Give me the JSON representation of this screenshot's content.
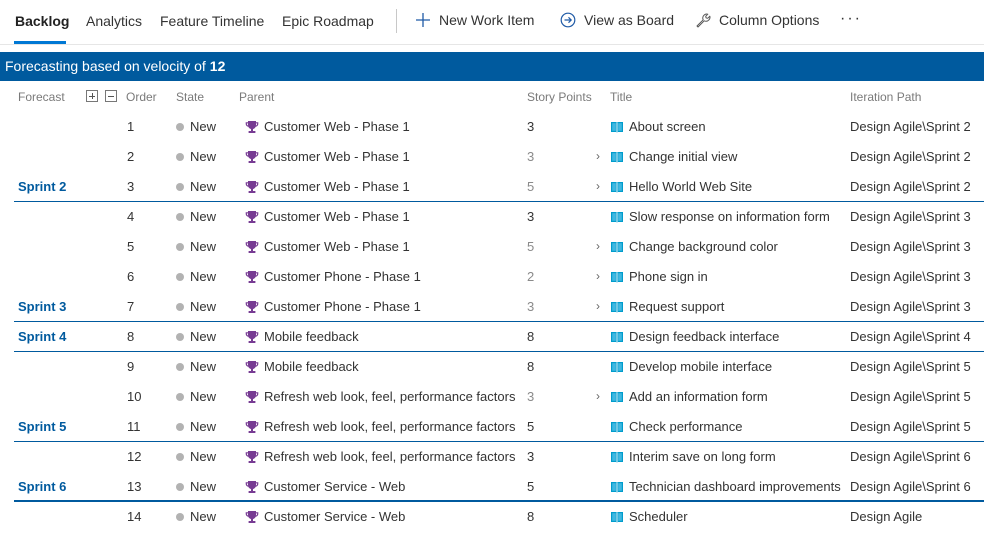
{
  "tabs": [
    {
      "label": "Backlog",
      "active": true
    },
    {
      "label": "Analytics",
      "active": false
    },
    {
      "label": "Feature Timeline",
      "active": false
    },
    {
      "label": "Epic Roadmap",
      "active": false
    }
  ],
  "toolbar": {
    "new_item": "New Work Item",
    "view_board": "View as Board",
    "column_options": "Column Options",
    "more": "···"
  },
  "banner": {
    "text": "Forecasting based on velocity of",
    "velocity": "12"
  },
  "colors": {
    "accent": "#005a9e",
    "tab_underline": "#0078d4",
    "epic_icon": "#773b93",
    "story_icon": "#009ccc",
    "state_new": "#b2b2b2"
  },
  "columns": {
    "forecast": "Forecast",
    "order": "Order",
    "state": "State",
    "parent": "Parent",
    "story_points": "Story Points",
    "title": "Title",
    "iteration_path": "Iteration Path"
  },
  "rows": [
    {
      "forecast": "",
      "order": "1",
      "state": "New",
      "parent": "Customer Web - Phase 1",
      "points": "3",
      "points_muted": false,
      "has_children": false,
      "title": "About screen",
      "path": "Design Agile\\Sprint 2",
      "sep": ""
    },
    {
      "forecast": "",
      "order": "2",
      "state": "New",
      "parent": "Customer Web - Phase 1",
      "points": "3",
      "points_muted": true,
      "has_children": true,
      "title": "Change initial view",
      "path": "Design Agile\\Sprint 2",
      "sep": ""
    },
    {
      "forecast": "Sprint 2",
      "order": "3",
      "state": "New",
      "parent": "Customer Web - Phase 1",
      "points": "5",
      "points_muted": true,
      "has_children": true,
      "title": "Hello World Web Site",
      "path": "Design Agile\\Sprint 2",
      "sep": "thin"
    },
    {
      "forecast": "",
      "order": "4",
      "state": "New",
      "parent": "Customer Web - Phase 1",
      "points": "3",
      "points_muted": false,
      "has_children": false,
      "title": "Slow response on information form",
      "path": "Design Agile\\Sprint 3",
      "sep": ""
    },
    {
      "forecast": "",
      "order": "5",
      "state": "New",
      "parent": "Customer Web - Phase 1",
      "points": "5",
      "points_muted": true,
      "has_children": true,
      "title": "Change background color",
      "path": "Design Agile\\Sprint 3",
      "sep": ""
    },
    {
      "forecast": "",
      "order": "6",
      "state": "New",
      "parent": "Customer Phone - Phase 1",
      "points": "2",
      "points_muted": true,
      "has_children": true,
      "title": "Phone sign in",
      "path": "Design Agile\\Sprint 3",
      "sep": ""
    },
    {
      "forecast": "Sprint 3",
      "order": "7",
      "state": "New",
      "parent": "Customer Phone - Phase 1",
      "points": "3",
      "points_muted": true,
      "has_children": true,
      "title": "Request support",
      "path": "Design Agile\\Sprint 3",
      "sep": "thin"
    },
    {
      "forecast": "Sprint 4",
      "order": "8",
      "state": "New",
      "parent": "Mobile feedback",
      "points": "8",
      "points_muted": false,
      "has_children": false,
      "title": "Design feedback interface",
      "path": "Design Agile\\Sprint 4",
      "sep": "thin"
    },
    {
      "forecast": "",
      "order": "9",
      "state": "New",
      "parent": "Mobile feedback",
      "points": "8",
      "points_muted": false,
      "has_children": false,
      "title": "Develop mobile interface",
      "path": "Design Agile\\Sprint 5",
      "sep": ""
    },
    {
      "forecast": "",
      "order": "10",
      "state": "New",
      "parent": "Refresh web look, feel, performance factors",
      "points": "3",
      "points_muted": true,
      "has_children": true,
      "title": "Add an information form",
      "path": "Design Agile\\Sprint 5",
      "sep": ""
    },
    {
      "forecast": "Sprint 5",
      "order": "11",
      "state": "New",
      "parent": "Refresh web look, feel, performance factors",
      "points": "5",
      "points_muted": false,
      "has_children": false,
      "title": "Check performance",
      "path": "Design Agile\\Sprint 5",
      "sep": "thin"
    },
    {
      "forecast": "",
      "order": "12",
      "state": "New",
      "parent": "Refresh web look, feel, performance factors",
      "points": "3",
      "points_muted": false,
      "has_children": false,
      "title": "Interim save on long form",
      "path": "Design Agile\\Sprint 6",
      "sep": ""
    },
    {
      "forecast": "Sprint 6",
      "order": "13",
      "state": "New",
      "parent": "Customer Service - Web",
      "points": "5",
      "points_muted": false,
      "has_children": false,
      "title": "Technician dashboard improvements",
      "path": "Design Agile\\Sprint 6",
      "sep": "thick"
    },
    {
      "forecast": "",
      "order": "14",
      "state": "New",
      "parent": "Customer Service - Web",
      "points": "8",
      "points_muted": false,
      "has_children": false,
      "title": "Scheduler",
      "path": "Design Agile",
      "sep": ""
    }
  ]
}
